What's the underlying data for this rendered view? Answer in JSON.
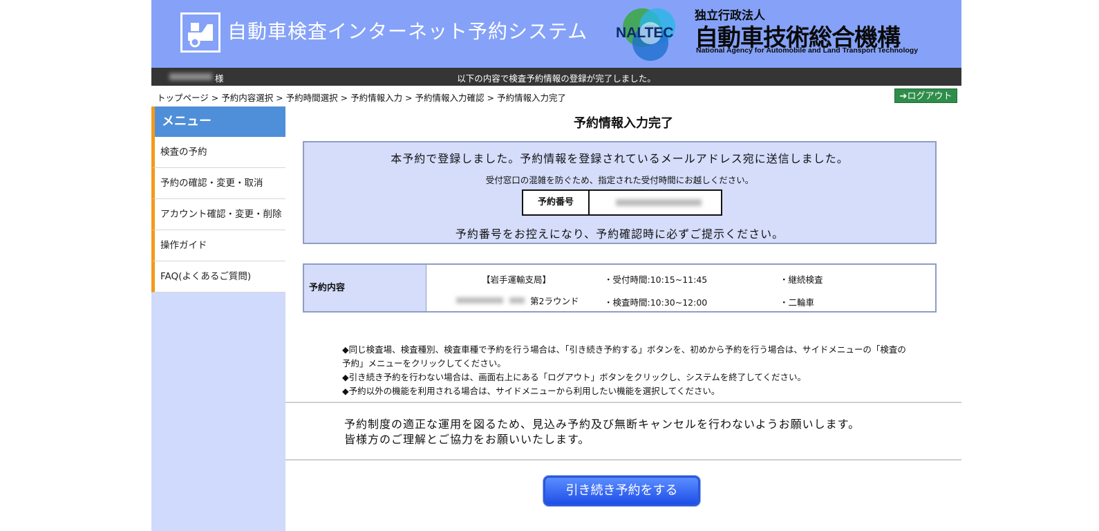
{
  "header": {
    "system_title": "自動車検査インターネット予約システム",
    "naltec_logo_text": "NALTEC",
    "org_type": "独立行政法人",
    "org_name": "自動車技術総合機構",
    "org_name_en": "National Agency for Automobile and Land Transport Technology"
  },
  "statusbar": {
    "user_suffix": "様",
    "message": "以下の内容で検査予約情報の登録が完了しました。"
  },
  "breadcrumb": [
    "トップページ",
    "予約内容選択",
    "予約時間選択",
    "予約情報入力",
    "予約情報入力確認",
    "予約情報入力完了"
  ],
  "breadcrumb_separator": " > ",
  "logout_label": "ログアウト",
  "sidebar": {
    "heading": "メニュー",
    "items": [
      {
        "label": "検査の予約"
      },
      {
        "label": "予約の確認・変更・取消"
      },
      {
        "label": "アカウント確認・変更・削除"
      },
      {
        "label": "操作ガイド"
      },
      {
        "label": "FAQ(よくあるご質問)"
      }
    ]
  },
  "main": {
    "title": "予約情報入力完了",
    "notice": {
      "line1": "本予約で登録しました。予約情報を登録されているメールアドレス宛に送信しました。",
      "line2": "受付窓口の混雑を防ぐため、指定された受付時間にお越しください。",
      "reservation_number_label": "予約番号",
      "line3": "予約番号をお控えになり、予約確認時に必ずご提示ください。"
    },
    "details": {
      "label": "予約内容",
      "office": "【岩手運輸支局】",
      "round": "第2ラウンド",
      "reception_time": "・受付時間:10:15~11:45",
      "inspection_time": "・検査時間:10:30~12:00",
      "inspection_type": "・継続検査",
      "vehicle_type": "・二輪車"
    },
    "guide": [
      "◆同じ検査場、検査種別、検査車種で予約を行う場合は、「引き続き予約する」ボタンを、初めから予約を行う場合は、サイドメニューの「検査の予約」メニューをクリックしてください。",
      "◆引き続き予約を行わない場合は、画面右上にある「ログアウト」ボタンをクリックし、システムを終了してください。",
      "◆予約以外の機能を利用される場合は、サイドメニューから利用したい機能を選択してください。"
    ],
    "caution_line1": "予約制度の適正な運用を図るため、見込み予約及び無断キャンセルを行わないようお願いします。",
    "caution_line2": "皆様方のご理解とご協力をお願いいたします。",
    "continue_button": "引き続き予約をする"
  },
  "colors": {
    "header_bg": "#85a2f8",
    "statusbar_bg": "#353535",
    "sidebar_bg": "#cfdafc",
    "menu_head_bg": "#4f8fd9",
    "accent_orange": "#f39a1a",
    "notice_bg": "#d5ddfb",
    "logout_bg": "#2f8d4a",
    "button_blue": "#1f4fe8"
  },
  "icons": {
    "logo": "truck-logo-icon",
    "logout": "arrow-right-icon"
  }
}
